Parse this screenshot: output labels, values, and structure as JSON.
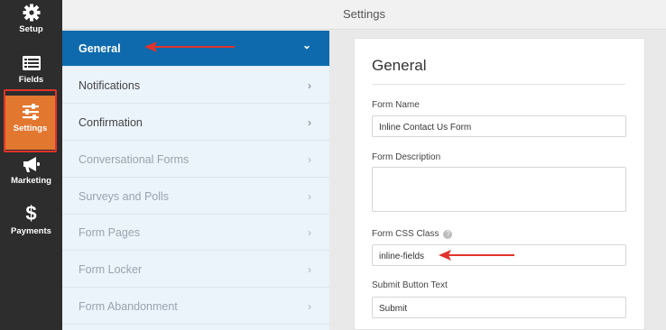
{
  "rail": {
    "items": [
      {
        "label": "Setup",
        "icon": "gear-icon"
      },
      {
        "label": "Fields",
        "icon": "fields-list-icon"
      },
      {
        "label": "Settings",
        "icon": "sliders-icon"
      },
      {
        "label": "Marketing",
        "icon": "megaphone-icon"
      },
      {
        "label": "Payments",
        "icon": "dollar-icon"
      }
    ],
    "active": "Settings",
    "active_color": "#e27730"
  },
  "header": {
    "title": "Settings"
  },
  "sections": [
    {
      "label": "General",
      "chevron": "⌄",
      "state": "active"
    },
    {
      "label": "Notifications",
      "chevron": "›"
    },
    {
      "label": "Confirmation",
      "chevron": "›"
    },
    {
      "label": "Conversational Forms",
      "chevron": "›",
      "state": "disabled"
    },
    {
      "label": "Surveys and Polls",
      "chevron": "›",
      "state": "disabled"
    },
    {
      "label": "Form Pages",
      "chevron": "›",
      "state": "disabled"
    },
    {
      "label": "Form Locker",
      "chevron": "›",
      "state": "disabled"
    },
    {
      "label": "Form Abandonment",
      "chevron": "›",
      "state": "disabled"
    }
  ],
  "panel": {
    "title": "General",
    "form_name_label": "Form Name",
    "form_name_value": "Inline Contact Us Form",
    "form_description_label": "Form Description",
    "form_description_value": "",
    "css_class_label": "Form CSS Class",
    "css_class_help": "?",
    "css_class_value": "inline-fields",
    "submit_text_label": "Submit Button Text",
    "submit_text_value": "Submit"
  },
  "colors": {
    "accent_blue": "#0e6aad",
    "annotation_red": "#e0332b"
  }
}
